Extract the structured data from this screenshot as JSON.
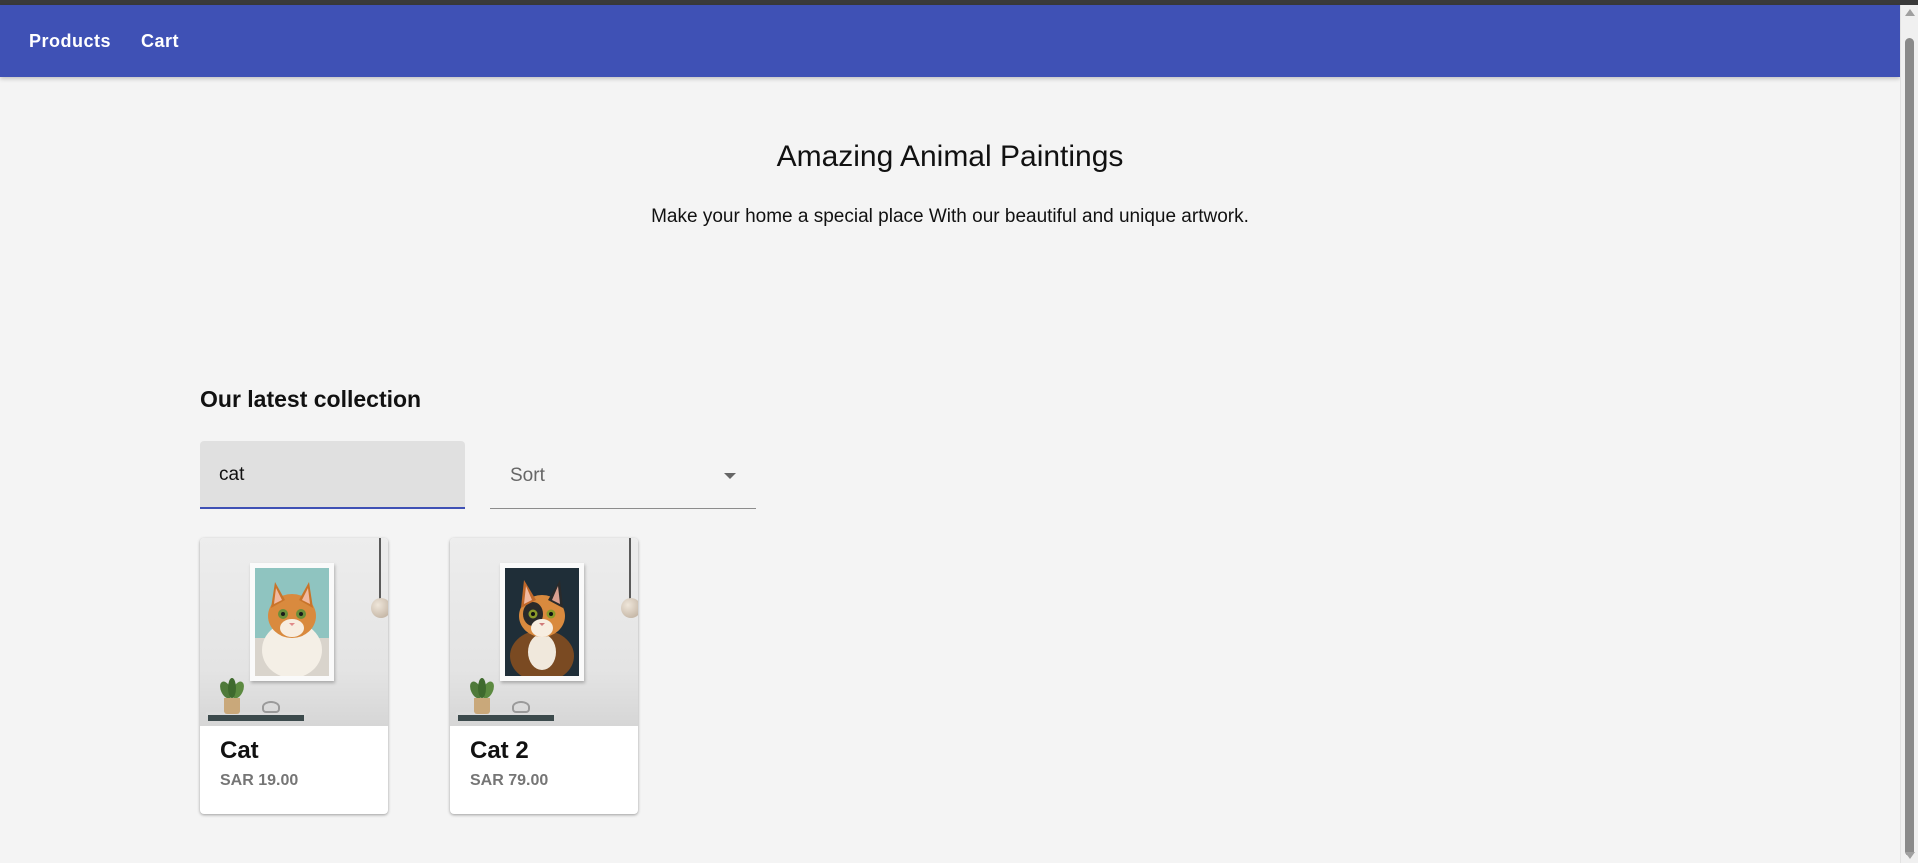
{
  "colors": {
    "primary": "#3f51b5",
    "background": "#f4f4f4"
  },
  "navbar": {
    "links": [
      "Products",
      "Cart"
    ]
  },
  "hero": {
    "title": "Amazing Animal Paintings",
    "subtitle": "Make your home a special place With our beautiful and unique artwork."
  },
  "collection": {
    "title": "Our latest collection",
    "search": {
      "value": "cat"
    },
    "sort": {
      "label": "Sort",
      "icon": "chevron-down-icon"
    },
    "products": [
      {
        "name": "Cat",
        "price": "SAR 19.00",
        "image": "cat-painting-teal-background"
      },
      {
        "name": "Cat 2",
        "price": "SAR 79.00",
        "image": "cat-painting-dark-background"
      }
    ]
  }
}
